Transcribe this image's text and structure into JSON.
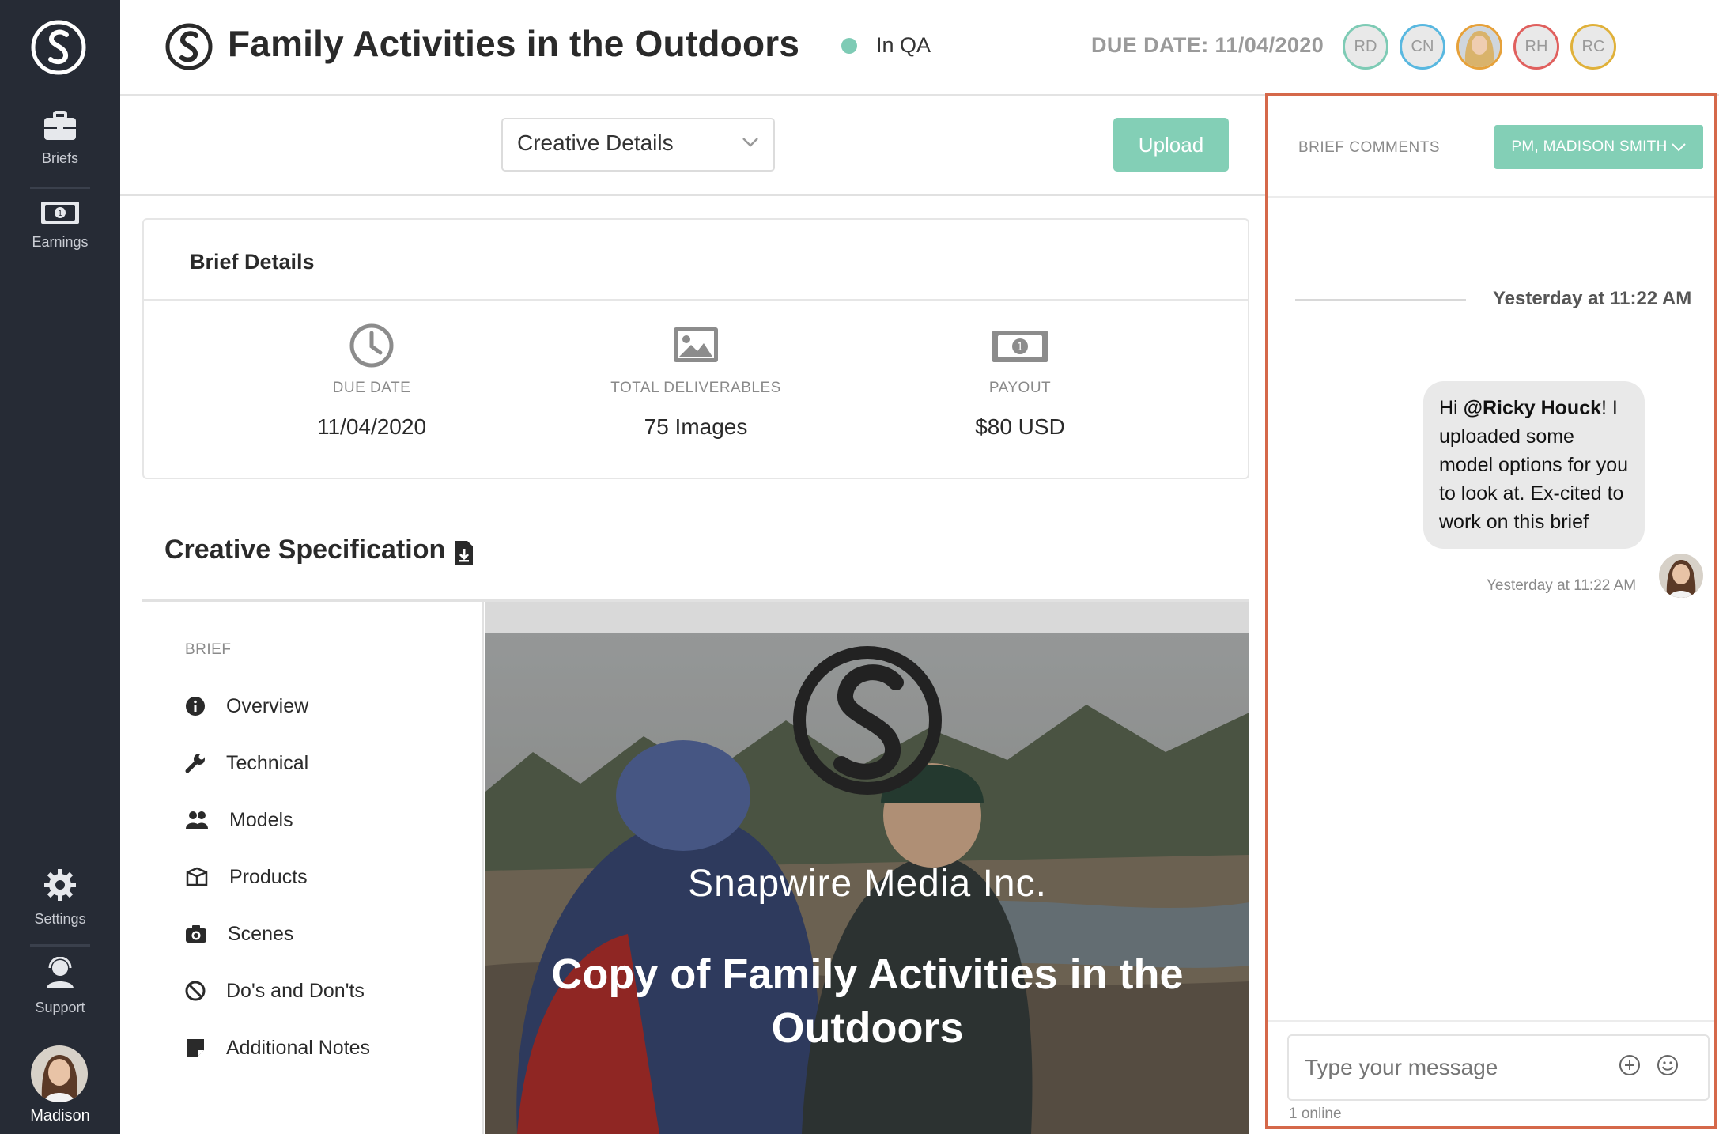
{
  "sidebar": {
    "items": [
      {
        "label": "Briefs",
        "icon": "briefcase-icon"
      },
      {
        "label": "Earnings",
        "icon": "money-icon"
      },
      {
        "label": "Settings",
        "icon": "gear-icon"
      },
      {
        "label": "Support",
        "icon": "support-icon"
      }
    ],
    "user_name": "Madison"
  },
  "header": {
    "title": "Family Activities in the Outdoors",
    "status": "In QA",
    "status_color": "#7ecbb5",
    "due_date_label": "DUE DATE: 11/04/2020",
    "avatars": [
      {
        "initials": "RD",
        "ring": "#7ecbb5"
      },
      {
        "initials": "CN",
        "ring": "#59b8e0"
      },
      {
        "initials": "",
        "ring": "#e6a13a",
        "photo": true
      },
      {
        "initials": "RH",
        "ring": "#e0605e"
      },
      {
        "initials": "RC",
        "ring": "#e0b13a"
      }
    ]
  },
  "toolbar": {
    "section_select": "Creative Details",
    "upload_label": "Upload"
  },
  "brief_details": {
    "title": "Brief Details",
    "stats": [
      {
        "label": "DUE DATE",
        "value": "11/04/2020",
        "icon": "clock-icon"
      },
      {
        "label": "TOTAL DELIVERABLES",
        "value": "75 Images",
        "icon": "image-icon"
      },
      {
        "label": "PAYOUT",
        "value": "$80 USD",
        "icon": "money-icon"
      }
    ]
  },
  "creative_spec": {
    "title": "Creative Specification",
    "nav_label": "BRIEF",
    "nav_items": [
      {
        "label": "Overview",
        "icon": "info-icon"
      },
      {
        "label": "Technical",
        "icon": "wrench-icon"
      },
      {
        "label": "Models",
        "icon": "users-icon"
      },
      {
        "label": "Products",
        "icon": "box-icon"
      },
      {
        "label": "Scenes",
        "icon": "camera-icon"
      },
      {
        "label": "Do's and Don'ts",
        "icon": "ban-icon"
      },
      {
        "label": "Additional Notes",
        "icon": "note-icon"
      }
    ],
    "preview_company": "Snapwire Media Inc.",
    "preview_title": "Copy of Family Activities in the Outdoors"
  },
  "comments": {
    "title": "BRIEF COMMENTS",
    "user_button": "PM, MADISON SMITH",
    "date_divider": "Yesterday at 11:22 AM",
    "message": {
      "pre": "Hi ",
      "mention": "@Ricky Houck",
      "post": "! I uploaded some model options for you to look at. Ex-cited to work on this brief",
      "time": "Yesterday at 11:22 AM"
    },
    "input_placeholder": "Type your message",
    "online": "1 online"
  },
  "colors": {
    "accent": "#83cfb6",
    "sidebar_bg": "#262b35",
    "panel_border": "#d5684a"
  }
}
